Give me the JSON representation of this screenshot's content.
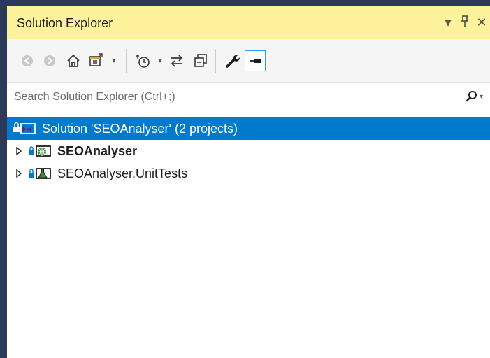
{
  "window": {
    "title": "Solution Explorer",
    "controls": {
      "dropdown_glyph": "▾",
      "pin_glyph": "ᵽ",
      "close_glyph": "✕"
    }
  },
  "toolbar": {
    "buttons": [
      {
        "name": "back-button",
        "icon": "back-circle-icon"
      },
      {
        "name": "forward-button",
        "icon": "forward-circle-icon"
      },
      {
        "name": "home-button",
        "icon": "home-icon"
      },
      {
        "name": "switch-views-button",
        "icon": "switch-views-icon"
      },
      {
        "name": "pending-changes-filter-button",
        "icon": "clock-filter-icon"
      },
      {
        "name": "sync-active-document-button",
        "icon": "sync-arrows-icon"
      },
      {
        "name": "collapse-all-button",
        "icon": "collapse-all-icon"
      },
      {
        "name": "properties-button",
        "icon": "wrench-icon"
      },
      {
        "name": "preview-selected-items-button",
        "icon": "preview-icon"
      }
    ]
  },
  "search": {
    "placeholder": "Search Solution Explorer (Ctrl+;)",
    "value": ""
  },
  "tree": {
    "solution": {
      "label": "Solution 'SEOAnalyser' (2 projects)",
      "selected": true
    },
    "projects": [
      {
        "label": "SEOAnalyser",
        "bold": true,
        "icon": "web-project-icon"
      },
      {
        "label": "SEOAnalyser.UnitTests",
        "bold": false,
        "icon": "test-project-icon"
      }
    ]
  },
  "colors": {
    "title_bar": "#fff29d",
    "selection": "#007acc",
    "outer_background": "#2b3a5a"
  }
}
